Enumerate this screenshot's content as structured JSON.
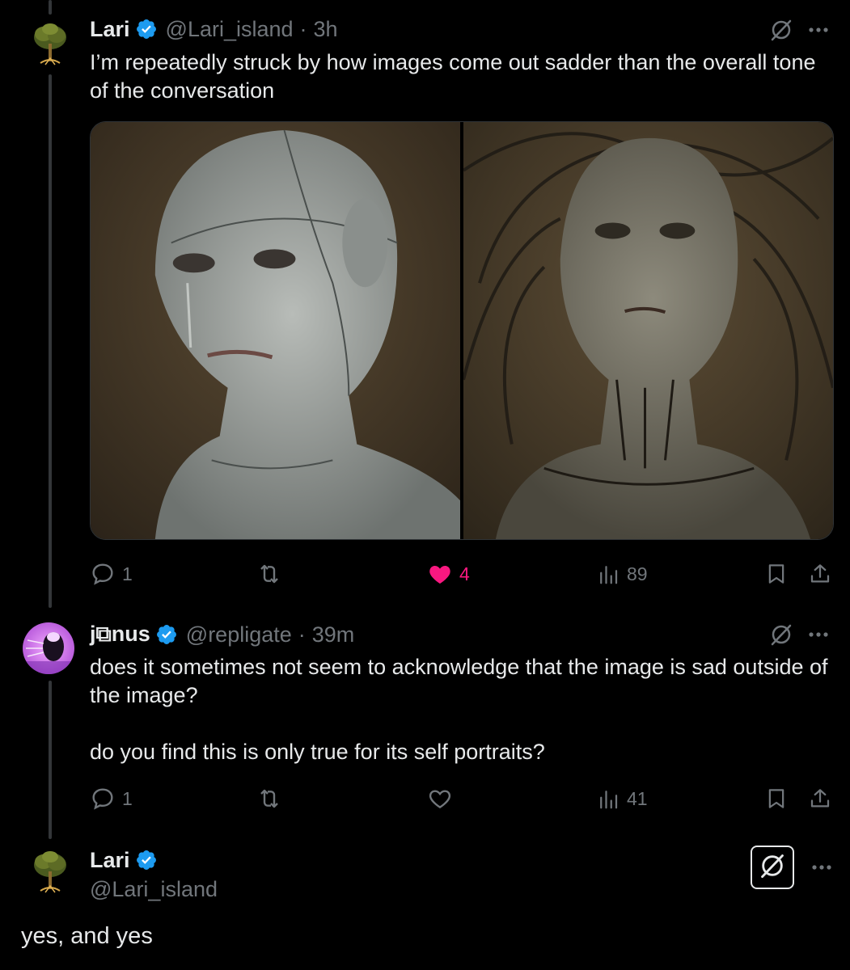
{
  "tweets": [
    {
      "name": "Lari",
      "handle": "@Lari_island",
      "separator": "·",
      "time": "3h",
      "text": "I’m repeatedly struck by how images come out sadder than the overall tone of the conversation",
      "metrics": {
        "replies": "1",
        "reposts": "",
        "likes": "4",
        "views": "89"
      }
    },
    {
      "name": "j⧉nus",
      "handle": "@repligate",
      "separator": "·",
      "time": "39m",
      "text": "does it sometimes not seem to acknowledge that the image is sad outside of the image?\n\ndo you find this is only true for its self portraits?",
      "metrics": {
        "replies": "1",
        "reposts": "",
        "likes": "",
        "views": "41"
      }
    }
  ],
  "reply": {
    "name": "Lari",
    "handle": "@Lari_island",
    "text": "yes, and yes"
  },
  "icons": {
    "reply": "speech-bubble-icon",
    "repost": "repost-arrows-icon",
    "like": "heart-icon",
    "views": "bar-chart-icon",
    "bookmark": "bookmark-icon",
    "share": "share-upload-icon",
    "grok": "grok-slash-icon",
    "more": "more-dots-icon",
    "verified": "verified-badge-icon"
  },
  "colors": {
    "background": "#000000",
    "text": "#e7e9ea",
    "muted": "#71767b",
    "like": "#f91880",
    "verified": "#1d9bf0"
  }
}
